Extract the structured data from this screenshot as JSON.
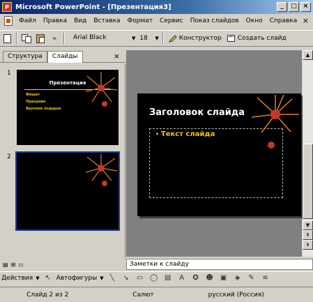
{
  "window": {
    "title": "Microsoft PowerPoint - [Презентация3]",
    "app_icon_letter": "P",
    "minimize_label": "_",
    "maximize_label": "□",
    "close_label": "×"
  },
  "menu": {
    "items": [
      "Файл",
      "Правка",
      "Вид",
      "Вставка",
      "Формат",
      "Сервис",
      "Показ слайдов",
      "Окно",
      "Справка"
    ],
    "close_label": "×"
  },
  "toolbar": {
    "font_name": "Arial Black",
    "font_size": "18",
    "constructor_label": "Конструктор",
    "new_slide_label": "Создать слайд"
  },
  "left_panel": {
    "tabs": [
      "Структура",
      "Слайды"
    ],
    "close_label": "×",
    "slides": [
      {
        "number": "1",
        "title": "Презентация",
        "bullets": [
          "Фишет",
          "Праздник",
          "Вручено подарок"
        ]
      },
      {
        "number": "2"
      }
    ]
  },
  "slide": {
    "title": "Заголовок слайда",
    "text": "Текст слайда"
  },
  "notes": {
    "placeholder": "Заметки к слайду"
  },
  "drawbar": {
    "actions_label": "Действия",
    "autoshapes_label": "Автофигуры"
  },
  "status": {
    "slide_info": "Слайд 2 из 2",
    "design": "Салют",
    "language": "русский (Россия)"
  },
  "colors": {
    "slide_bg": "#000000",
    "slide_text": "#f1c40f",
    "thumb_border_selected": "#1c3f94",
    "workspace": "#808080"
  }
}
